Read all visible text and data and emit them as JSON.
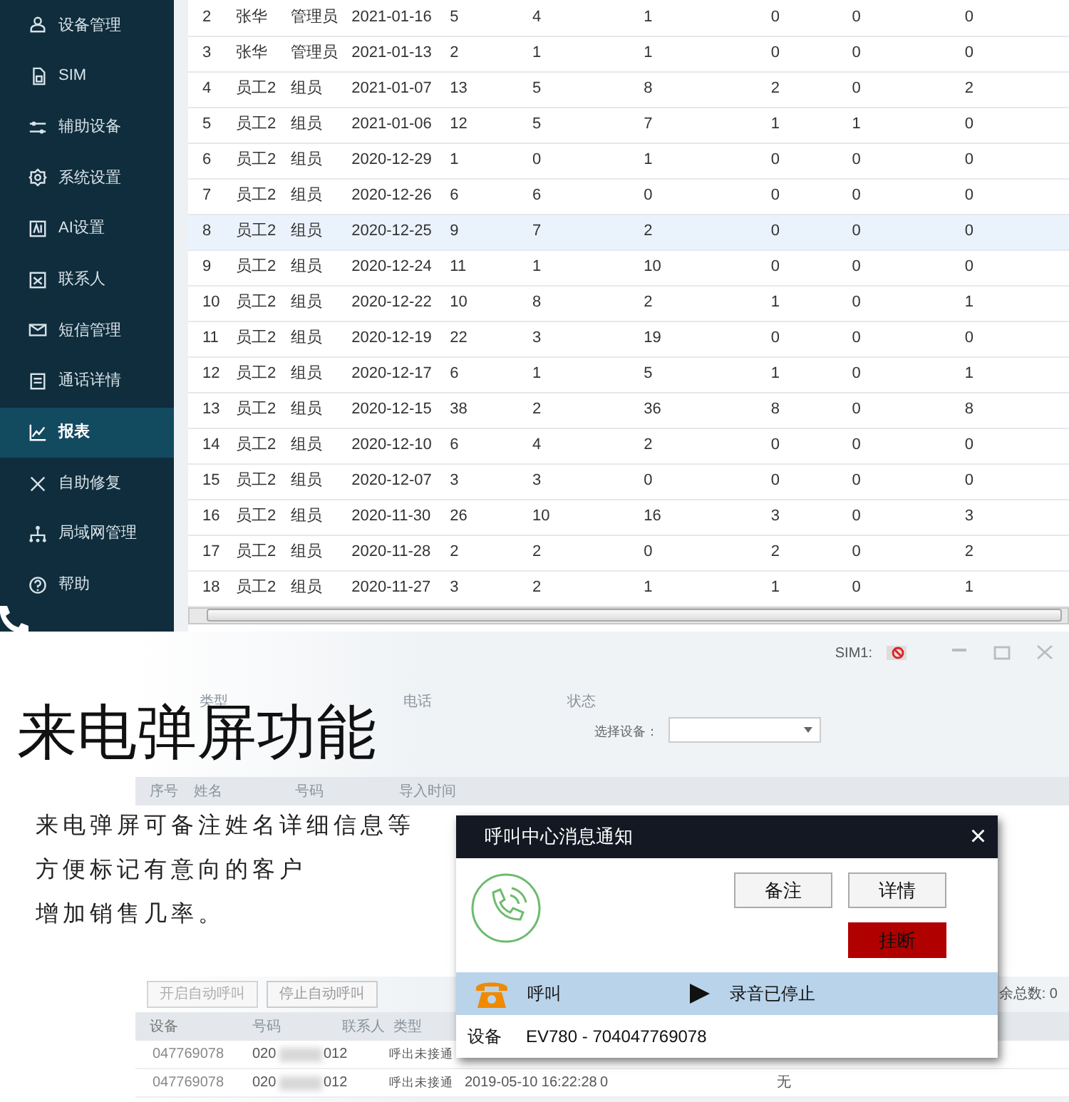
{
  "sidebar": {
    "items": [
      {
        "label": "设备管理",
        "selected": false
      },
      {
        "label": "SIM",
        "selected": false
      },
      {
        "label": "辅助设备",
        "selected": false
      },
      {
        "label": "系统设置",
        "selected": false
      },
      {
        "label": "AI设置",
        "selected": false
      },
      {
        "label": "联系人",
        "selected": false
      },
      {
        "label": "短信管理",
        "selected": false
      },
      {
        "label": "通话详情",
        "selected": false
      },
      {
        "label": "报表",
        "selected": true
      },
      {
        "label": "自助修复",
        "selected": false
      },
      {
        "label": "局域网管理",
        "selected": false
      },
      {
        "label": "帮助",
        "selected": false
      }
    ]
  },
  "report_table": {
    "rows": [
      {
        "cells": [
          "2",
          "张华",
          "管理员",
          "2021-01-16",
          "5",
          "4",
          "1",
          "0",
          "0",
          "0"
        ],
        "selected": false
      },
      {
        "cells": [
          "3",
          "张华",
          "管理员",
          "2021-01-13",
          "2",
          "1",
          "1",
          "0",
          "0",
          "0"
        ],
        "selected": false
      },
      {
        "cells": [
          "4",
          "员工2",
          "组员",
          "2021-01-07",
          "13",
          "5",
          "8",
          "2",
          "0",
          "2"
        ],
        "selected": false
      },
      {
        "cells": [
          "5",
          "员工2",
          "组员",
          "2021-01-06",
          "12",
          "5",
          "7",
          "1",
          "1",
          "0"
        ],
        "selected": false
      },
      {
        "cells": [
          "6",
          "员工2",
          "组员",
          "2020-12-29",
          "1",
          "0",
          "1",
          "0",
          "0",
          "0"
        ],
        "selected": false
      },
      {
        "cells": [
          "7",
          "员工2",
          "组员",
          "2020-12-26",
          "6",
          "6",
          "0",
          "0",
          "0",
          "0"
        ],
        "selected": false
      },
      {
        "cells": [
          "8",
          "员工2",
          "组员",
          "2020-12-25",
          "9",
          "7",
          "2",
          "0",
          "0",
          "0"
        ],
        "selected": true
      },
      {
        "cells": [
          "9",
          "员工2",
          "组员",
          "2020-12-24",
          "11",
          "1",
          "10",
          "0",
          "0",
          "0"
        ],
        "selected": false
      },
      {
        "cells": [
          "10",
          "员工2",
          "组员",
          "2020-12-22",
          "10",
          "8",
          "2",
          "1",
          "0",
          "1"
        ],
        "selected": false
      },
      {
        "cells": [
          "11",
          "员工2",
          "组员",
          "2020-12-19",
          "22",
          "3",
          "19",
          "0",
          "0",
          "0"
        ],
        "selected": false
      },
      {
        "cells": [
          "12",
          "员工2",
          "组员",
          "2020-12-17",
          "6",
          "1",
          "5",
          "1",
          "0",
          "1"
        ],
        "selected": false
      },
      {
        "cells": [
          "13",
          "员工2",
          "组员",
          "2020-12-15",
          "38",
          "2",
          "36",
          "8",
          "0",
          "8"
        ],
        "selected": false
      },
      {
        "cells": [
          "14",
          "员工2",
          "组员",
          "2020-12-10",
          "6",
          "4",
          "2",
          "0",
          "0",
          "0"
        ],
        "selected": false
      },
      {
        "cells": [
          "15",
          "员工2",
          "组员",
          "2020-12-07",
          "3",
          "3",
          "0",
          "0",
          "0",
          "0"
        ],
        "selected": false
      },
      {
        "cells": [
          "16",
          "员工2",
          "组员",
          "2020-11-30",
          "26",
          "10",
          "16",
          "3",
          "0",
          "3"
        ],
        "selected": false
      },
      {
        "cells": [
          "17",
          "员工2",
          "组员",
          "2020-11-28",
          "2",
          "2",
          "0",
          "2",
          "0",
          "2"
        ],
        "selected": false
      },
      {
        "cells": [
          "18",
          "员工2",
          "组员",
          "2020-11-27",
          "3",
          "2",
          "1",
          "1",
          "0",
          "1"
        ],
        "selected": false
      }
    ]
  },
  "background_app": {
    "sim_label": "SIM1:",
    "filter_labels": [
      "类型",
      "电话",
      "状态"
    ],
    "device_select_label": "选择设备：",
    "import_columns": [
      "序号",
      "姓名",
      "号码",
      "导入时间"
    ],
    "buttons": [
      "开启自动呼叫",
      "停止自动呼叫"
    ],
    "remaining": "余总数: 0",
    "call_columns": [
      "设备",
      "号码",
      "联系人",
      "类型"
    ],
    "call_rows": [
      {
        "device": "047769078",
        "phone_start": "020",
        "phone_end": "012",
        "type": "呼出未接通"
      },
      {
        "device": "047769078",
        "phone_start": "020",
        "phone_end": "012",
        "type": "呼出未接通",
        "time": "2019-05-10 16:22:28",
        "count": "0",
        "contact_state": "无"
      }
    ]
  },
  "promo": {
    "heading": "来电弹屏功能",
    "lines": [
      "来电弹屏可备注姓名详细信息等",
      "方便标记有意向的客户",
      "增加销售几率。"
    ]
  },
  "popup": {
    "title": "呼叫中心消息通知",
    "close": "×",
    "buttons": [
      {
        "label": "备注",
        "kind": "plain"
      },
      {
        "label": "详情",
        "kind": "plain"
      },
      {
        "label": "挂断",
        "kind": "danger"
      }
    ],
    "call_label": "呼叫",
    "recording": "录音已停止",
    "device_label": "设备",
    "device": "EV780 - 704047769078"
  }
}
